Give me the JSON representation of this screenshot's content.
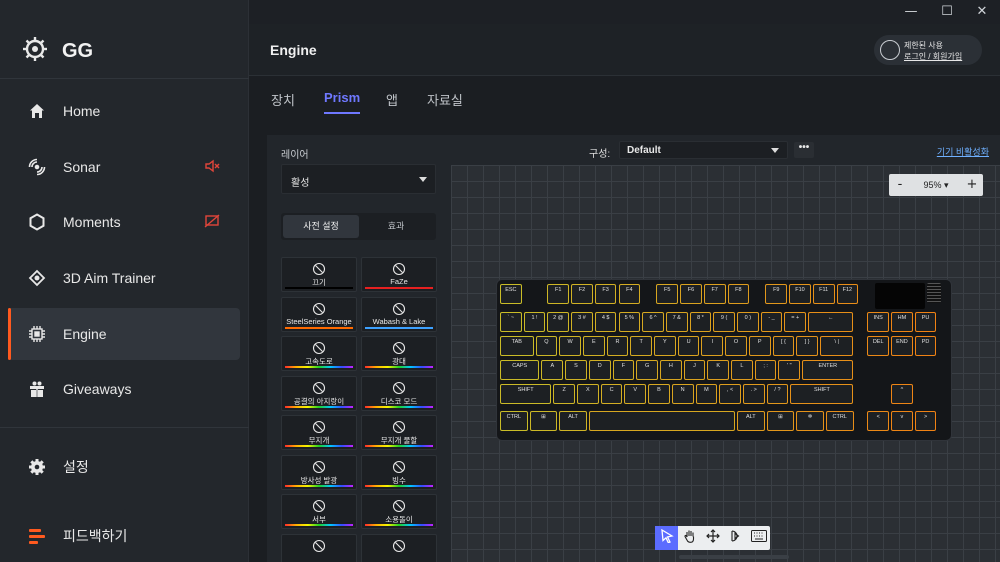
{
  "window": {
    "minimize": "—",
    "maximize": "☐",
    "close": "✕"
  },
  "brand": {
    "name": "GG"
  },
  "nav": [
    {
      "label": "Home",
      "icon": "home-icon"
    },
    {
      "label": "Sonar",
      "icon": "sonar-icon",
      "badge": "speaker-muted-icon"
    },
    {
      "label": "Moments",
      "icon": "hexagon-icon",
      "badge": "camera-off-icon"
    },
    {
      "label": "3D Aim Trainer",
      "icon": "crosshair-icon"
    },
    {
      "label": "Engine",
      "icon": "chip-icon",
      "active": true
    },
    {
      "label": "Giveaways",
      "icon": "gift-icon"
    }
  ],
  "nav_bottom": [
    {
      "label": "설정",
      "icon": "gear-icon"
    },
    {
      "label": "피드백하기",
      "icon": "feedback-icon"
    }
  ],
  "header": {
    "title": "Engine",
    "login_line1": "제한된 사용",
    "login_line2": "로그인 / 회원가입"
  },
  "tabs": [
    {
      "label": "장치"
    },
    {
      "label": "Prism",
      "active": true
    },
    {
      "label": "앱"
    },
    {
      "label": "자료실"
    }
  ],
  "left_panel": {
    "layer_label": "레이어",
    "layer_value": "활성",
    "segment_presets": "사전 설정",
    "segment_effects": "효과"
  },
  "presets": [
    {
      "label": "끄기",
      "icon": "off-icon",
      "bar": "#000000"
    },
    {
      "label": "FaZe",
      "icon": "faze-icon",
      "bar": "#e62020"
    },
    {
      "label": "SteelSeries Orange",
      "icon": "steelseries-icon",
      "bar": "#ff6a00"
    },
    {
      "label": "Wabash & Lake",
      "icon": "dots-icon",
      "bar": "#3da1ff"
    },
    {
      "label": "고속도로",
      "icon": "highway-icon",
      "bar": "rainbow"
    },
    {
      "label": "광대",
      "icon": "clown-icon",
      "bar": "rainbow"
    },
    {
      "label": "공결의 아지랑이",
      "icon": "waves-icon",
      "bar": "rainbow"
    },
    {
      "label": "디스코 모드",
      "icon": "disco-icon",
      "bar": "rainbow"
    },
    {
      "label": "무지개",
      "icon": "rainbow-icon",
      "bar": "rainbow"
    },
    {
      "label": "무지개 물할",
      "icon": "rainbow-split-icon",
      "bar": "rainbow"
    },
    {
      "label": "방사성 발광",
      "icon": "radioactive-icon",
      "bar": "rainbow"
    },
    {
      "label": "빙수",
      "icon": "icecream-icon",
      "bar": "rainbow"
    },
    {
      "label": "서부",
      "icon": "palm-icon",
      "bar": "rainbow"
    },
    {
      "label": "소용돌이",
      "icon": "swirl-icon",
      "bar": "rainbow"
    },
    {
      "label": "",
      "icon": "lightning-icon",
      "bar": "rainbow"
    },
    {
      "label": "",
      "icon": "water-icon",
      "bar": "rainbow"
    }
  ],
  "config": {
    "label": "구성:",
    "value": "Default",
    "more": "•••",
    "device_link": "기기 비활성화"
  },
  "zoom": {
    "minus": "-",
    "value": "95%",
    "plus": "+"
  },
  "keyboard": {
    "rows": [
      [
        "ESC",
        "F1",
        "F2",
        "F3",
        "F4",
        "F5",
        "F6",
        "F7",
        "F8",
        "F9",
        "F10",
        "F11",
        "F12"
      ],
      [
        "` ~",
        "1 !",
        "2 @",
        "3 #",
        "4 $",
        "5 %",
        "6 ^",
        "7 &",
        "8 *",
        "9 (",
        "0 )",
        "- _",
        "= +",
        "←",
        "INS",
        "HM",
        "PU"
      ],
      [
        "TAB",
        "Q",
        "W",
        "E",
        "R",
        "T",
        "Y",
        "U",
        "I",
        "O",
        "P",
        "[ {",
        "] }",
        "\\ |",
        "DEL",
        "END",
        "PD"
      ],
      [
        "CAPS",
        "A",
        "S",
        "D",
        "F",
        "G",
        "H",
        "J",
        "K",
        "L",
        "; :",
        "' \"",
        "ENTER"
      ],
      [
        "SHIFT",
        "Z",
        "X",
        "C",
        "V",
        "B",
        "N",
        "M",
        ", <",
        ". >",
        "/ ?",
        "SHIFT",
        "^"
      ],
      [
        "CTRL",
        "⊞",
        "ALT",
        "",
        "ALT",
        "⊞",
        "✲",
        "CTRL",
        "<",
        "v",
        ">"
      ]
    ]
  },
  "tools": [
    "select-icon",
    "hand-icon",
    "move-icon",
    "play-icon",
    "keyboard-icon"
  ]
}
